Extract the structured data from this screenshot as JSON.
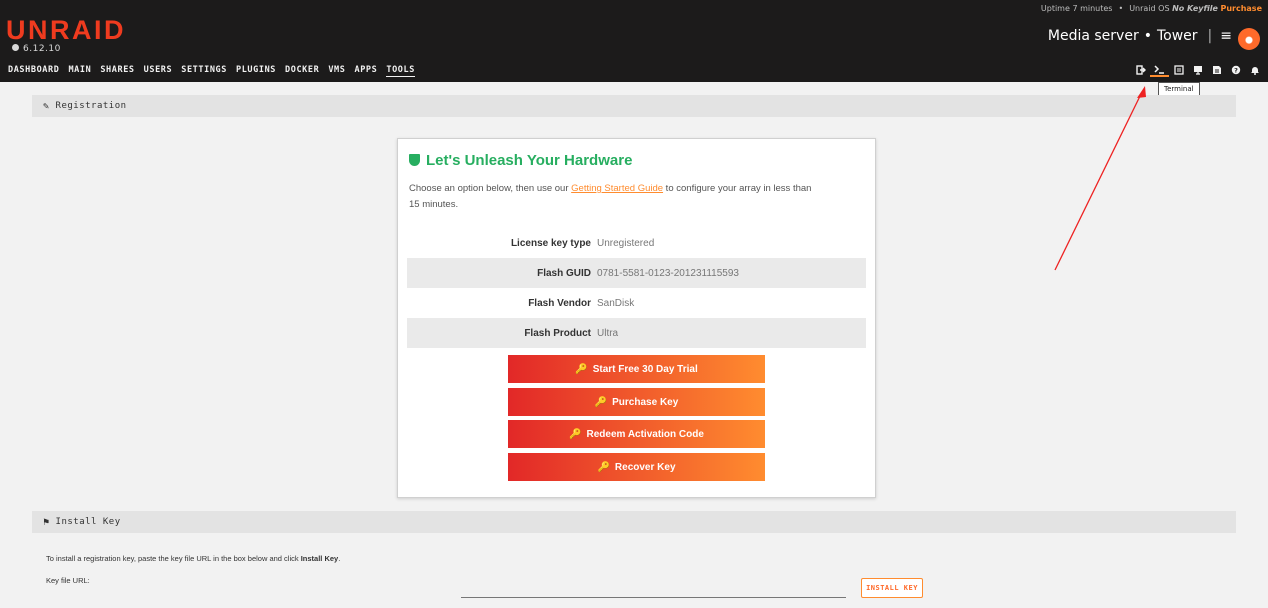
{
  "header": {
    "logo": "UNRAID",
    "version": "6.12.10",
    "uptime": "Uptime 7 minutes",
    "os_label": "Unraid OS",
    "no_keyfile": "No Keyfile",
    "purchase": "Purchase",
    "server_description": "Media server",
    "server_name": "Tower",
    "nav": [
      "DASHBOARD",
      "MAIN",
      "SHARES",
      "USERS",
      "SETTINGS",
      "PLUGINS",
      "DOCKER",
      "VMS",
      "APPS",
      "TOOLS"
    ],
    "active_nav": "TOOLS",
    "icons": [
      "logout-icon",
      "terminal-icon",
      "feedback-icon",
      "info-icon",
      "log-icon",
      "help-icon",
      "notifications-icon"
    ],
    "tooltip": "Terminal"
  },
  "registration": {
    "section_title": "Registration",
    "card_title": "Let's Unleash Your Hardware",
    "desc_before": "Choose an option below, then use our ",
    "desc_link": "Getting Started Guide",
    "desc_after": " to configure your array in less than 15 minutes.",
    "info": [
      {
        "label": "License key type",
        "value": "Unregistered"
      },
      {
        "label": "Flash GUID",
        "value": "0781-5581-0123-201231115593"
      },
      {
        "label": "Flash Vendor",
        "value": "SanDisk"
      },
      {
        "label": "Flash Product",
        "value": "Ultra"
      }
    ],
    "buttons": [
      "Start Free 30 Day Trial",
      "Purchase Key",
      "Redeem Activation Code",
      "Recover Key"
    ]
  },
  "install": {
    "section_title": "Install Key",
    "instructions_before": "To install a registration key, paste the key file URL in the box below and click ",
    "instructions_bold": "Install Key",
    "instructions_after": ".",
    "keyfile_label": "Key file URL:",
    "keyfile_value": "",
    "button": "INSTALL KEY"
  },
  "colors": {
    "brand": "#ef3b1f",
    "accent": "#ff8c2f",
    "success": "#27ae60",
    "header_bg": "#1c1b1b"
  }
}
